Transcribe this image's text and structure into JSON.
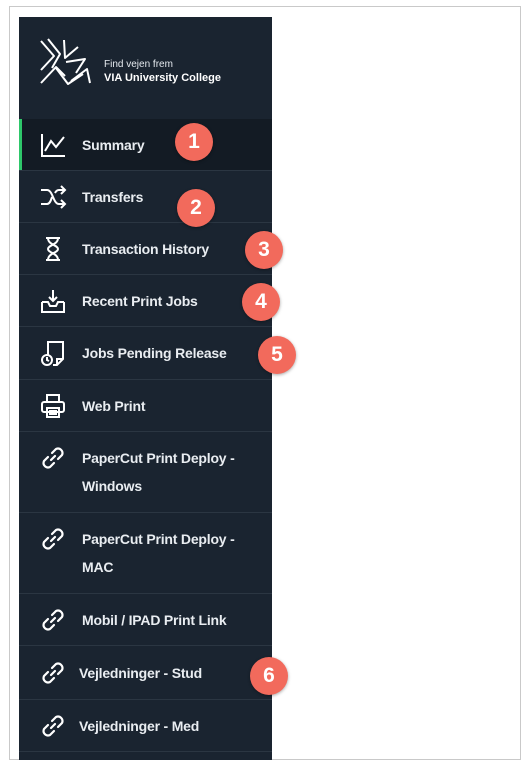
{
  "brand": {
    "tagline": "Find vejen frem",
    "name": "VIA University College"
  },
  "nav": {
    "items": [
      {
        "label": "Summary",
        "icon": "chart-line-icon",
        "active": true
      },
      {
        "label": "Transfers",
        "icon": "shuffle-icon"
      },
      {
        "label": "Transaction History",
        "icon": "hourglass-icon"
      },
      {
        "label": "Recent Print Jobs",
        "icon": "inbox-tray-icon"
      },
      {
        "label": "Jobs Pending Release",
        "icon": "document-pending-icon"
      },
      {
        "label": "Web Print",
        "icon": "printer-icon"
      },
      {
        "label": "PaperCut Print Deploy - Windows",
        "icon": "link-icon"
      },
      {
        "label": "PaperCut Print Deploy - MAC",
        "icon": "link-icon"
      },
      {
        "label": "Mobil / IPAD Print Link",
        "icon": "link-icon"
      },
      {
        "label": "Vejledninger - Stud",
        "icon": "link-icon"
      },
      {
        "label": "Vejledninger - Med",
        "icon": "link-icon"
      }
    ]
  },
  "badges": [
    "1",
    "2",
    "3",
    "4",
    "5",
    "6"
  ],
  "colors": {
    "sidebar_bg": "#1a2430",
    "active_bg": "#131b24",
    "active_accent": "#2ec76a",
    "badge": "#f26a5c"
  }
}
